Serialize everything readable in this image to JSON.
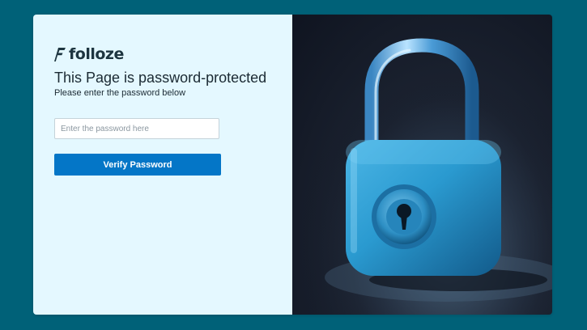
{
  "brand": {
    "name": "folloze",
    "icon": "folloze-logo-icon"
  },
  "page": {
    "title": "This Page is password-protected",
    "subtitle": "Please enter the password below"
  },
  "form": {
    "password_placeholder": "Enter the password here",
    "password_value": "",
    "verify_label": "Verify Password"
  },
  "image": {
    "subject": "padlock-illustration"
  },
  "colors": {
    "page_background": "#006178",
    "panel_background": "#e4f8ff",
    "button": "#0476c7",
    "lock_body": "#2a9ad0",
    "image_background": "#141a26"
  }
}
